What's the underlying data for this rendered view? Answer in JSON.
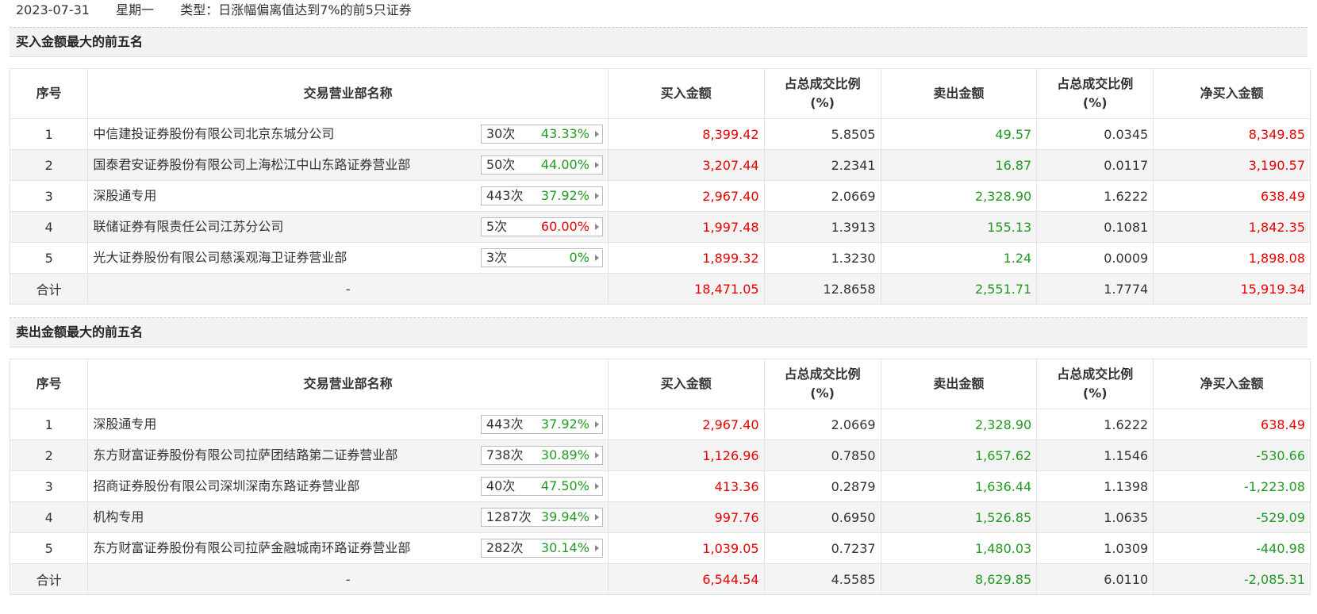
{
  "header": {
    "date": "2023-07-31",
    "weekday": "星期一",
    "type_text": "类型：日涨幅偏离值达到7%的前5只证券"
  },
  "columns": {
    "index": "序号",
    "dept": "交易营业部名称",
    "buy": "买入金额",
    "buy_ratio_line1": "占总成交比例",
    "buy_ratio_line2": "(%)",
    "sell": "卖出金额",
    "sell_ratio_line1": "占总成交比例",
    "sell_ratio_line2": "(%)",
    "net": "净买入金额"
  },
  "buy_section": {
    "title": "买入金额最大的前五名",
    "rows": [
      {
        "idx": "1",
        "name": "中信建投证券股份有限公司北京东城分公司",
        "times": "30次",
        "pct": "43.33%",
        "pct_color": "green",
        "buy": "8,399.42",
        "buy_ratio": "5.8505",
        "sell": "49.57",
        "sell_ratio": "0.0345",
        "net": "8,349.85",
        "net_color": "red"
      },
      {
        "idx": "2",
        "name": "国泰君安证券股份有限公司上海松江中山东路证券营业部",
        "times": "50次",
        "pct": "44.00%",
        "pct_color": "green",
        "buy": "3,207.44",
        "buy_ratio": "2.2341",
        "sell": "16.87",
        "sell_ratio": "0.0117",
        "net": "3,190.57",
        "net_color": "red"
      },
      {
        "idx": "3",
        "name": "深股通专用",
        "times": "443次",
        "pct": "37.92%",
        "pct_color": "green",
        "buy": "2,967.40",
        "buy_ratio": "2.0669",
        "sell": "2,328.90",
        "sell_ratio": "1.6222",
        "net": "638.49",
        "net_color": "red"
      },
      {
        "idx": "4",
        "name": "联储证券有限责任公司江苏分公司",
        "times": "5次",
        "pct": "60.00%",
        "pct_color": "red",
        "buy": "1,997.48",
        "buy_ratio": "1.3913",
        "sell": "155.13",
        "sell_ratio": "0.1081",
        "net": "1,842.35",
        "net_color": "red"
      },
      {
        "idx": "5",
        "name": "光大证券股份有限公司慈溪观海卫证券营业部",
        "times": "3次",
        "pct": "0%",
        "pct_color": "green",
        "buy": "1,899.32",
        "buy_ratio": "1.3230",
        "sell": "1.24",
        "sell_ratio": "0.0009",
        "net": "1,898.08",
        "net_color": "red"
      }
    ],
    "total": {
      "label": "合计",
      "dash": "-",
      "buy": "18,471.05",
      "buy_ratio": "12.8658",
      "sell": "2,551.71",
      "sell_ratio": "1.7774",
      "net": "15,919.34",
      "net_color": "red"
    }
  },
  "sell_section": {
    "title": "卖出金额最大的前五名",
    "rows": [
      {
        "idx": "1",
        "name": "深股通专用",
        "times": "443次",
        "pct": "37.92%",
        "pct_color": "green",
        "buy": "2,967.40",
        "buy_ratio": "2.0669",
        "sell": "2,328.90",
        "sell_ratio": "1.6222",
        "net": "638.49",
        "net_color": "red"
      },
      {
        "idx": "2",
        "name": "东方财富证券股份有限公司拉萨团结路第二证券营业部",
        "times": "738次",
        "pct": "30.89%",
        "pct_color": "green",
        "buy": "1,126.96",
        "buy_ratio": "0.7850",
        "sell": "1,657.62",
        "sell_ratio": "1.1546",
        "net": "-530.66",
        "net_color": "green"
      },
      {
        "idx": "3",
        "name": "招商证券股份有限公司深圳深南东路证券营业部",
        "times": "40次",
        "pct": "47.50%",
        "pct_color": "green",
        "buy": "413.36",
        "buy_ratio": "0.2879",
        "sell": "1,636.44",
        "sell_ratio": "1.1398",
        "net": "-1,223.08",
        "net_color": "green"
      },
      {
        "idx": "4",
        "name": "机构专用",
        "times": "1287次",
        "pct": "39.94%",
        "pct_color": "green",
        "buy": "997.76",
        "buy_ratio": "0.6950",
        "sell": "1,526.85",
        "sell_ratio": "1.0635",
        "net": "-529.09",
        "net_color": "green"
      },
      {
        "idx": "5",
        "name": "东方财富证券股份有限公司拉萨金融城南环路证券营业部",
        "times": "282次",
        "pct": "30.14%",
        "pct_color": "green",
        "buy": "1,039.05",
        "buy_ratio": "0.7237",
        "sell": "1,480.03",
        "sell_ratio": "1.0309",
        "net": "-440.98",
        "net_color": "green"
      }
    ],
    "total": {
      "label": "合计",
      "dash": "-",
      "buy": "6,544.54",
      "buy_ratio": "4.5585",
      "sell": "8,629.85",
      "sell_ratio": "6.0110",
      "net": "-2,085.31",
      "net_color": "green"
    }
  }
}
